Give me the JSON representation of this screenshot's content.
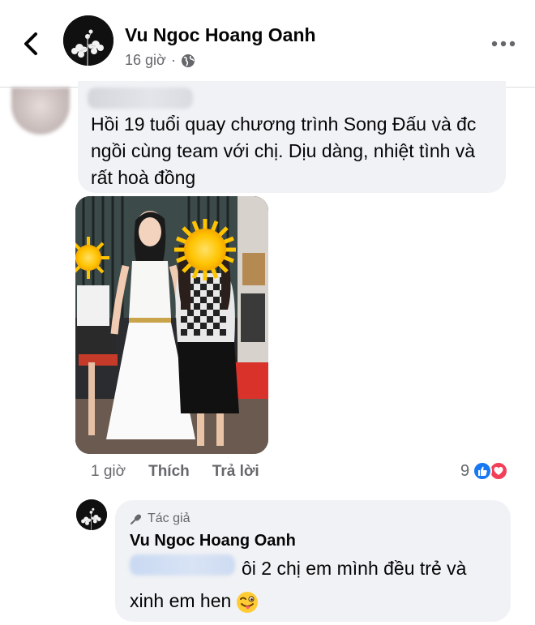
{
  "header": {
    "author_name": "Vu Ngoc Hoang Oanh",
    "time": "16 giờ",
    "privacy_icon": "globe-icon",
    "back_icon": "chevron-left-icon",
    "more_icon": "more-icon"
  },
  "comment": {
    "text": "Hồi 19 tuổi quay chương trình Song Đấu và đc ngồi cùng team với chị. Dịu dàng, nhiệt tình và rất hoà đồng",
    "time": "1 giờ",
    "like_label": "Thích",
    "reply_label": "Trả lời",
    "reaction_count": "9",
    "reaction_icons": [
      "like-reaction-icon",
      "love-reaction-icon"
    ]
  },
  "reply": {
    "badge": "Tác giả",
    "author_name": "Vu Ngoc Hoang Oanh",
    "text": "ôi 2 chị em mình đều trẻ và xinh em hen",
    "emoji": "winking-tongue-emoji"
  },
  "colors": {
    "bubble": "#f0f2f5",
    "secondary_text": "#65676b",
    "like_blue": "#1877f2",
    "love_red": "#f33e58"
  }
}
